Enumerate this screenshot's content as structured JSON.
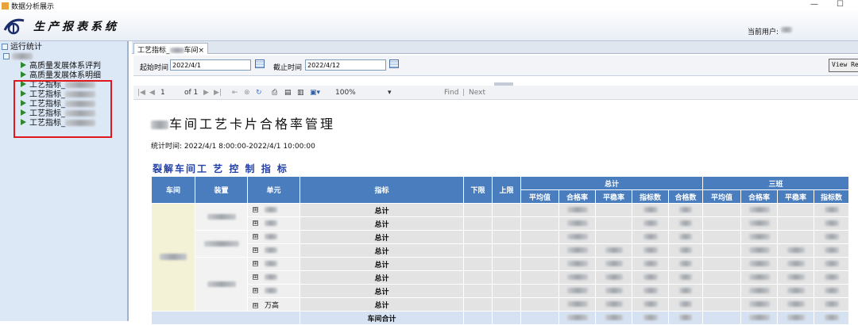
{
  "window": {
    "title": "数据分析展示",
    "minimize": "—",
    "maximize": "☐"
  },
  "header": {
    "system_title": "生产报表系统",
    "user_label": "当前用户:"
  },
  "sidebar": {
    "root": "运行统计",
    "items": [
      {
        "label": "高质量发展体系评判"
      },
      {
        "label": "高质量发展体系明细"
      },
      {
        "label": "工艺指标_"
      },
      {
        "label": "工艺指标_"
      },
      {
        "label": "工艺指标_"
      },
      {
        "label": "工艺指标_"
      },
      {
        "label": "工艺指标_"
      }
    ]
  },
  "tabs": [
    {
      "label": "工艺指标_",
      "label_suffix": "车间",
      "close": "×"
    }
  ],
  "filter": {
    "start_label": "起始时间",
    "start_value": "2022/4/1",
    "end_label": "截止时间",
    "end_value": "2022/4/12",
    "view_button": "View Report"
  },
  "toolbar": {
    "page_current": "1",
    "page_of": "of 1",
    "zoom": "100%",
    "find": "Find",
    "separator": "|",
    "next": "Next"
  },
  "report": {
    "title_suffix": "车间工艺卡片合格率管理",
    "stat_time": "统计时间: 2022/4/1 8:00:00-2022/4/1 10:00:00",
    "subtitle": "裂解车间工 艺 控 制 指 标",
    "headers": {
      "workshop": "车间",
      "device": "装置",
      "unit": "单元",
      "indicator": "指标",
      "lower": "下限",
      "upper": "上限",
      "group_total": "总计",
      "group_three": "三班",
      "avg": "平均值",
      "pass_rate": "合格率",
      "stable_rate": "平稳率",
      "index_count": "指标数",
      "pass_count": "合格数"
    },
    "rows": [
      {
        "unit": "",
        "indicator": "总计"
      },
      {
        "unit": "",
        "indicator": "总计"
      },
      {
        "unit": "",
        "indicator": "总计"
      },
      {
        "unit": "",
        "indicator": "总计"
      },
      {
        "unit": "",
        "indicator": "总计"
      },
      {
        "unit": "",
        "indicator": "总计"
      },
      {
        "unit": "",
        "indicator": "总计"
      },
      {
        "unit": "万高",
        "indicator": "总计"
      }
    ],
    "total_row": {
      "label": "车间合计"
    },
    "expand_symbol": "⊞"
  },
  "colors": {
    "header_blue": "#4a7dbe",
    "title_blue": "#2340a8",
    "highlight_red": "#e0181e",
    "tree_arrow": "#2d8a2d"
  }
}
